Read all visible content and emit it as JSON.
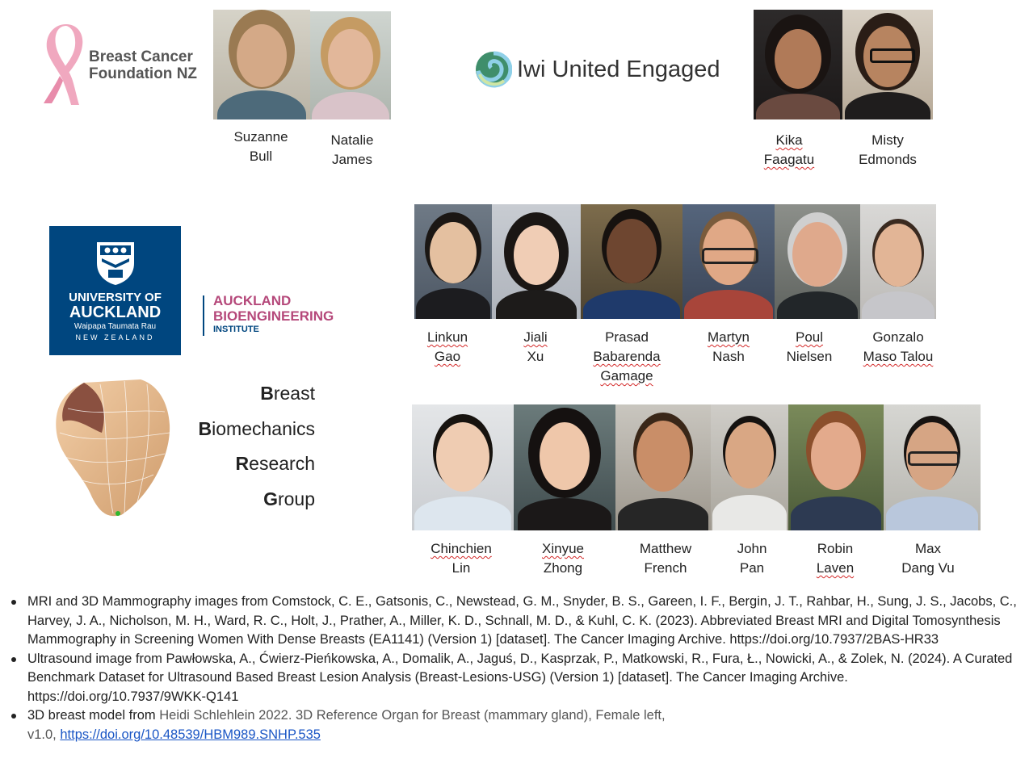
{
  "orgs": {
    "bcf": {
      "line1": "Breast Cancer",
      "line2": "Foundation NZ"
    },
    "iwi": {
      "name": "Iwi United Engaged"
    },
    "uoa": {
      "line1": "UNIVERSITY OF",
      "line2": "AUCKLAND",
      "line3": "Waipapa Taumata Rau",
      "line4": "NEW ZEALAND"
    },
    "abi": {
      "line1": "AUCKLAND",
      "line2": "BIOENGINEERING",
      "line3": "INSTITUTE"
    }
  },
  "bbrg": [
    {
      "initial": "B",
      "rest": "reast"
    },
    {
      "initial": "B",
      "rest": "iomechanics"
    },
    {
      "initial": "R",
      "rest": "esearch"
    },
    {
      "initial": "G",
      "rest": "roup"
    }
  ],
  "people": {
    "suzanne": {
      "first": "Suzanne",
      "last": "Bull"
    },
    "natalie": {
      "first": "Natalie",
      "last": "James"
    },
    "kika": {
      "first": "Kika",
      "last": "Faagatu"
    },
    "misty": {
      "first": "Misty",
      "last": "Edmonds"
    },
    "linkun": {
      "first": "Linkun",
      "last": "Gao"
    },
    "jiali": {
      "first": "Jiali",
      "last": "Xu"
    },
    "prasad": {
      "first": "Prasad",
      "middle": "Babarenda",
      "last": "Gamage"
    },
    "martyn": {
      "first": "Martyn",
      "last": "Nash"
    },
    "poul": {
      "first": "Poul",
      "last": "Nielsen"
    },
    "gonzalo": {
      "first": "Gonzalo",
      "last": "Maso Talou"
    },
    "chinchien": {
      "first": "Chinchien",
      "last": "Lin"
    },
    "xinyue": {
      "first": "Xinyue",
      "last": "Zhong"
    },
    "matthew": {
      "first": "Matthew",
      "last": "French"
    },
    "john": {
      "first": "John",
      "last": "Pan"
    },
    "robin": {
      "first": "Robin",
      "last": "Laven"
    },
    "max": {
      "first": "Max",
      "last": "Dang Vu"
    }
  },
  "references": [
    {
      "text": "MRI and 3D Mammography images from Comstock, C. E., Gatsonis, C., Newstead, G. M., Snyder, B. S., Gareen, I. F., Bergin, J. T., Rahbar, H., Sung, J. S., Jacobs, C., Harvey, J. A., Nicholson, M. H., Ward, R. C., Holt, J., Prather, A., Miller, K. D., Schnall, M. D., & Kuhl, C. K. (2023). Abbreviated Breast MRI and Digital Tomosynthesis Mammography in Screening Women With Dense Breasts (EA1141) (Version 1) [dataset]. The Cancer Imaging Archive. https://doi.org/10.7937/2BAS-HR33"
    },
    {
      "text": "Ultrasound image from Pawłowska, A., Ćwierz-Pieńkowska, A., Domalik, A., Jaguś, D., Kasprzak, P., Matkowski, R., Fura, Ł., Nowicki, A., & Zolek, N. (2024). A Curated Benchmark Dataset for Ultrasound Based Breast Lesion Analysis (Breast-Lesions-USG) (Version 1) [dataset]. The Cancer Imaging Archive. https://doi.org/10.7937/9WKK-Q141"
    },
    {
      "prefix": "3D breast model from ",
      "gray": "Heidi Schlehlein 2022. 3D Reference Organ for Breast (mammary gland), Female left,",
      "line2": "v1.0, ",
      "link": "https://doi.org/10.48539/HBM989.SNHP.535"
    }
  ]
}
